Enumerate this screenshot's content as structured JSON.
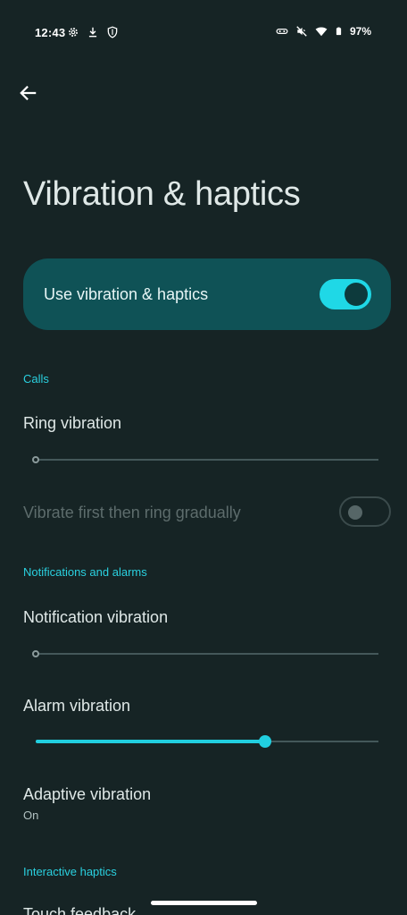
{
  "status_bar": {
    "time": "12:43",
    "battery_text": "97%",
    "left_icons": [
      "gear-icon",
      "download-icon",
      "shield-icon"
    ],
    "right_icons": [
      "link-icon",
      "mute-icon",
      "wifi-icon",
      "battery-icon"
    ]
  },
  "page": {
    "title": "Vibration & haptics"
  },
  "master_toggle": {
    "label": "Use vibration & haptics",
    "checked": true
  },
  "sections": {
    "calls": "Calls",
    "notifications": "Notifications and alarms",
    "interactive": "Interactive haptics"
  },
  "ring_vibration": {
    "label": "Ring vibration",
    "level": 0
  },
  "vibrate_first": {
    "label": "Vibrate first then ring gradually",
    "checked": false,
    "enabled": false
  },
  "notification_vibration": {
    "label": "Notification vibration",
    "level": 0
  },
  "alarm_vibration": {
    "label": "Alarm vibration",
    "level": 0.67
  },
  "adaptive_vibration": {
    "label": "Adaptive vibration",
    "summary": "On"
  },
  "touch_feedback": {
    "label": "Touch feedback"
  },
  "colors": {
    "accent": "#21cfe0",
    "background": "#162425",
    "card": "#0f5256"
  }
}
